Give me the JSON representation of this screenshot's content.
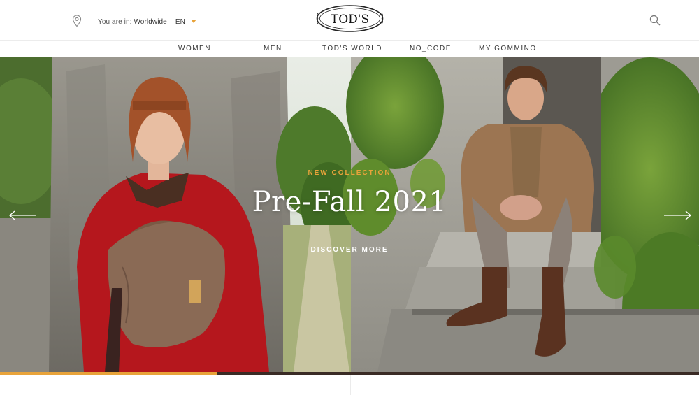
{
  "header": {
    "location_prefix": "You are in:",
    "location_value": "Worldwide",
    "language": "EN",
    "logo_text": "TOD'S",
    "icons": [
      "location-pin-icon",
      "search-icon",
      "chevron-down-icon"
    ]
  },
  "nav": {
    "items": [
      "WOMEN",
      "MEN",
      "TOD'S WORLD",
      "NO_CODE",
      "MY GOMMINO"
    ]
  },
  "hero": {
    "eyebrow": "NEW COLLECTION",
    "headline": "Pre-Fall 2021",
    "cta": "DISCOVER MORE",
    "slide_progress": 0.31
  },
  "colors": {
    "accent": "#e8a33a",
    "progress_track": "#3a2b25",
    "text": "#333333"
  }
}
